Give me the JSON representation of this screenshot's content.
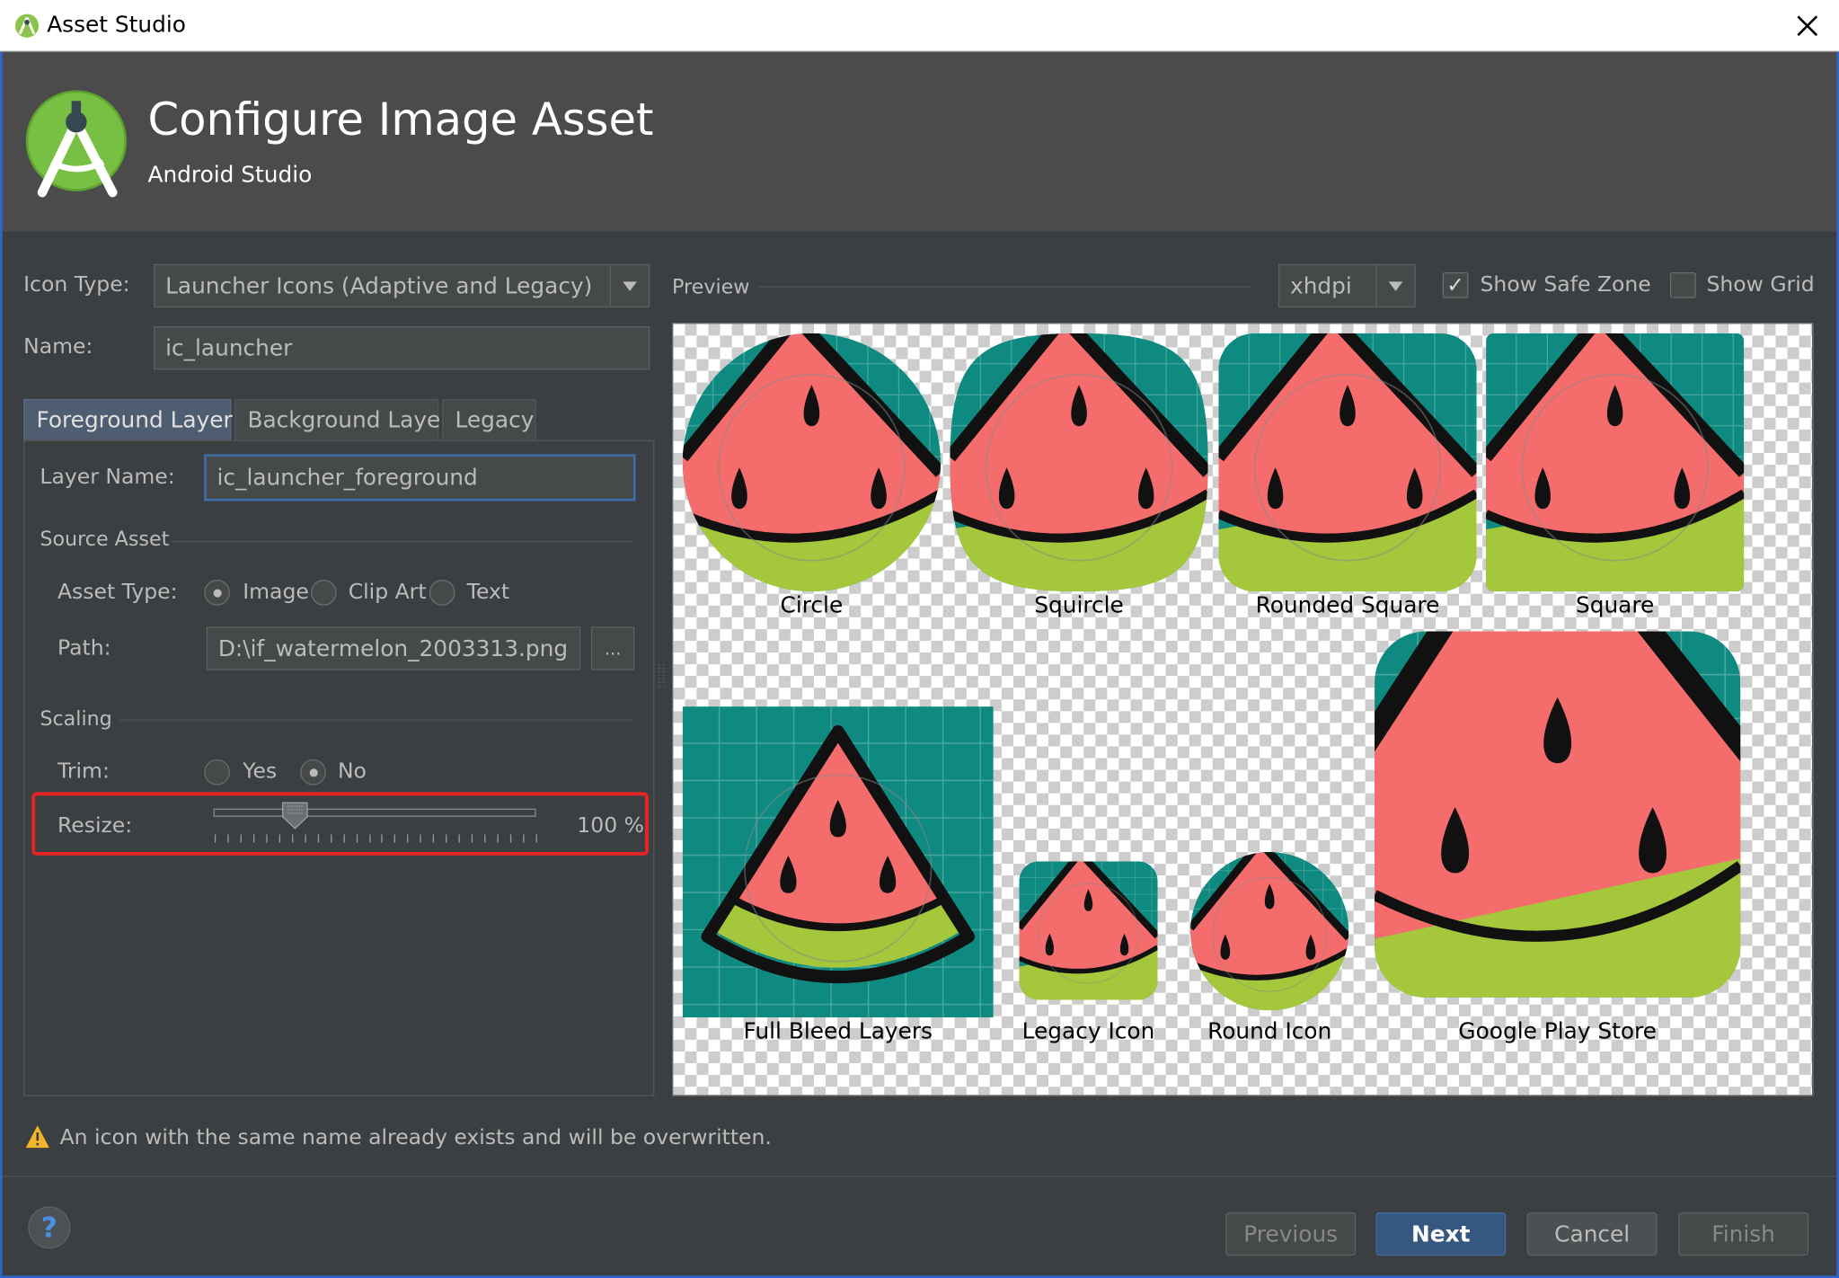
{
  "window": {
    "title": "Asset Studio"
  },
  "header": {
    "title": "Configure Image Asset",
    "subtitle": "Android Studio"
  },
  "form": {
    "icon_type_label": "Icon Type:",
    "icon_type_value": "Launcher Icons (Adaptive and Legacy)",
    "name_label": "Name:",
    "name_value": "ic_launcher"
  },
  "tabs": [
    {
      "label": "Foreground Layer",
      "selected": true
    },
    {
      "label": "Background Layer",
      "selected": false
    },
    {
      "label": "Legacy",
      "selected": false
    }
  ],
  "foreground": {
    "layer_name_label": "Layer Name:",
    "layer_name_value": "ic_launcher_foreground",
    "source_asset_heading": "Source Asset",
    "asset_type_label": "Asset Type:",
    "asset_type_options": [
      "Image",
      "Clip Art",
      "Text"
    ],
    "asset_type_selected": "Image",
    "path_label": "Path:",
    "path_value": "D:\\if_watermelon_2003313.png",
    "browse_label": "...",
    "scaling_heading": "Scaling",
    "trim_label": "Trim:",
    "trim_options": [
      "Yes",
      "No"
    ],
    "trim_selected": "No",
    "resize_label": "Resize:",
    "resize_value": "100 %",
    "resize_percent": 100
  },
  "preview": {
    "label": "Preview",
    "density_value": "xhdpi",
    "show_safe_zone_label": "Show Safe Zone",
    "show_safe_zone_checked": true,
    "show_grid_label": "Show Grid",
    "show_grid_checked": false,
    "icons": [
      {
        "label": "Circle",
        "shape": "circle"
      },
      {
        "label": "Squircle",
        "shape": "squircle"
      },
      {
        "label": "Rounded Square",
        "shape": "rounded-square"
      },
      {
        "label": "Square",
        "shape": "square"
      },
      {
        "label": "Full Bleed Layers",
        "shape": "full-bleed"
      },
      {
        "label": "Legacy Icon",
        "shape": "legacy"
      },
      {
        "label": "Round Icon",
        "shape": "round"
      },
      {
        "label": "Google Play Store",
        "shape": "play-store"
      }
    ]
  },
  "warning": {
    "text": "An icon with the same name already exists and will be overwritten."
  },
  "footer": {
    "previous": "Previous",
    "next": "Next",
    "cancel": "Cancel",
    "finish": "Finish",
    "help_glyph": "?"
  },
  "colors": {
    "accent": "#365880",
    "teal_background": "#0f8a80",
    "melon": "#f46c6c",
    "rind": "#a5c73b",
    "highlight": "#e52424",
    "frame": "#2f65ca"
  }
}
